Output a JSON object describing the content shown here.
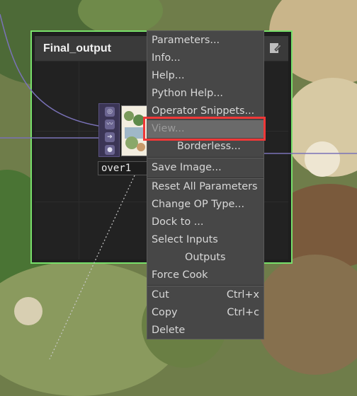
{
  "panel": {
    "title": "Final_output",
    "border_color": "#78e06a"
  },
  "node": {
    "label": "over1",
    "flags": [
      "target-flag-icon",
      "activity-icon",
      "arrow-right-icon",
      "paint-icon"
    ]
  },
  "context_menu": {
    "items": [
      {
        "label": "Parameters...",
        "enabled": true
      },
      {
        "label": "Info...",
        "enabled": true
      },
      {
        "label": "Help...",
        "enabled": true
      },
      {
        "label": "Python Help...",
        "enabled": true
      },
      {
        "label": "Operator Snippets...",
        "enabled": true
      },
      {
        "label": "View...",
        "enabled": false,
        "highlighted": true
      },
      {
        "label": "Borderless...",
        "enabled": true
      },
      {
        "label": "Save Image...",
        "enabled": true
      },
      {
        "label": "Reset All Parameters",
        "enabled": true
      },
      {
        "label": "Change OP Type...",
        "enabled": true
      },
      {
        "label": "Dock to ...",
        "enabled": true
      },
      {
        "label": "Select Inputs",
        "enabled": true
      },
      {
        "label": "Outputs",
        "enabled": true
      },
      {
        "label": "Force Cook",
        "enabled": true
      },
      {
        "label": "Cut",
        "shortcut": "Ctrl+x",
        "enabled": true
      },
      {
        "label": "Copy",
        "shortcut": "Ctrl+c",
        "enabled": true
      },
      {
        "label": "Delete",
        "enabled": true
      }
    ]
  },
  "annotation": {
    "highlight_color": "#f03838"
  }
}
